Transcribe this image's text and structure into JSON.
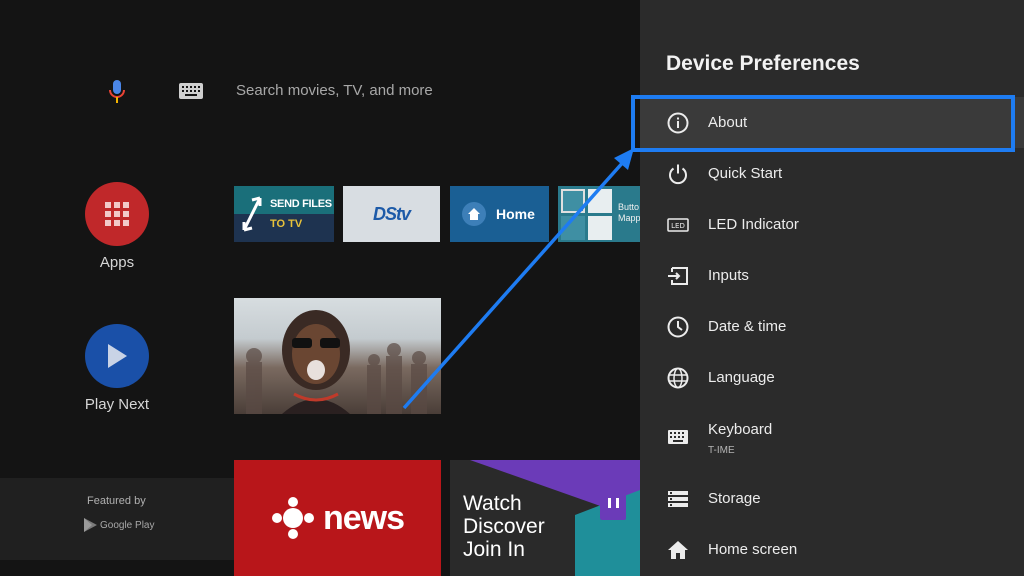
{
  "search": {
    "placeholder": "Search movies, TV, and more",
    "mic_icon": "mic-icon",
    "keyboard_icon": "keyboard-icon"
  },
  "left_nav": {
    "apps_label": "Apps",
    "play_next_label": "Play Next",
    "featured_by": "Featured by",
    "google_play": "Google Play"
  },
  "tiles": {
    "send_files_line1": "SEND FILES",
    "send_files_line2": "TO TV",
    "dstv": "DStv",
    "home": "Home",
    "button_mapper_line1": "Butto",
    "button_mapper_line2": "Mapp"
  },
  "bottom_tiles": {
    "news": "news",
    "twitch_line1": "Watch",
    "twitch_line2": "Discover",
    "twitch_line3": "Join In"
  },
  "panel": {
    "title": "Device Preferences",
    "items": [
      {
        "label": "About",
        "icon": "info-icon"
      },
      {
        "label": "Quick Start",
        "icon": "power-icon"
      },
      {
        "label": "LED Indicator",
        "icon": "led-icon"
      },
      {
        "label": "Inputs",
        "icon": "input-icon"
      },
      {
        "label": "Date & time",
        "icon": "clock-icon"
      },
      {
        "label": "Language",
        "icon": "globe-icon"
      },
      {
        "label": "Keyboard",
        "sublabel": "T-IME",
        "icon": "keyboard-icon"
      },
      {
        "label": "Storage",
        "icon": "storage-icon"
      },
      {
        "label": "Home screen",
        "icon": "home-icon"
      }
    ],
    "led_badge": "LED"
  },
  "colors": {
    "accent_annotation": "#1e7cf2",
    "panel_bg": "#2b2b2b",
    "apps_red": "#c0282a",
    "play_blue": "#1a50a8"
  }
}
